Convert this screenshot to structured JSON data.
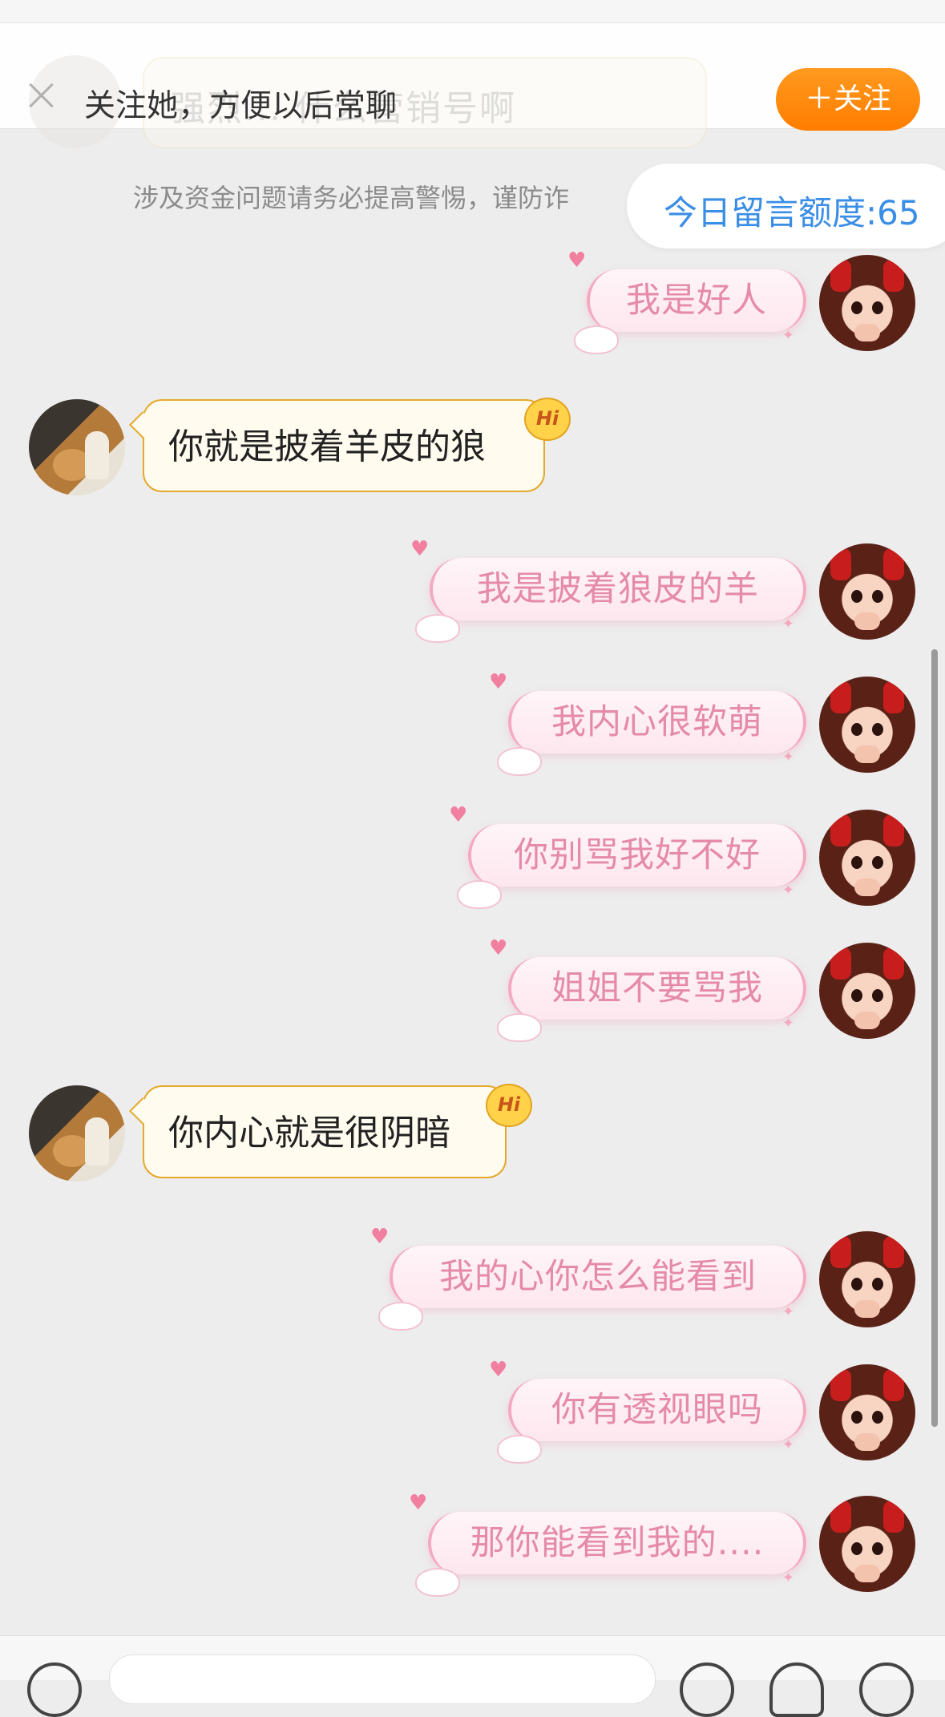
{
  "follow_bar": {
    "text": "关注她，方便以后常聊",
    "follow_button": "＋关注",
    "ghost_text": "强烈... 什么营销号啊"
  },
  "notice": "涉及资金问题请务必提高警惕，谨防诈",
  "quota": "今日留言额度:65",
  "messages": [
    {
      "side": "me",
      "text": "我是好人"
    },
    {
      "side": "her",
      "text": "你就是披着羊皮的狼",
      "badge": "Hi"
    },
    {
      "side": "me",
      "text": "我是披着狼皮的羊"
    },
    {
      "side": "me",
      "text": "我内心很软萌"
    },
    {
      "side": "me",
      "text": "你别骂我好不好"
    },
    {
      "side": "me",
      "text": "姐姐不要骂我"
    },
    {
      "side": "her",
      "text": "你内心就是很阴暗",
      "badge": "Hi"
    },
    {
      "side": "me",
      "text": "我的心你怎么能看到"
    },
    {
      "side": "me",
      "text": "你有透视眼吗"
    },
    {
      "side": "me",
      "text": "那你能看到我的...."
    }
  ],
  "colors": {
    "follow_button": "#ff8a00",
    "quota_text": "#3a8ee6",
    "pink_text": "#e58aa8",
    "yellow_border": "#e4a92b"
  }
}
